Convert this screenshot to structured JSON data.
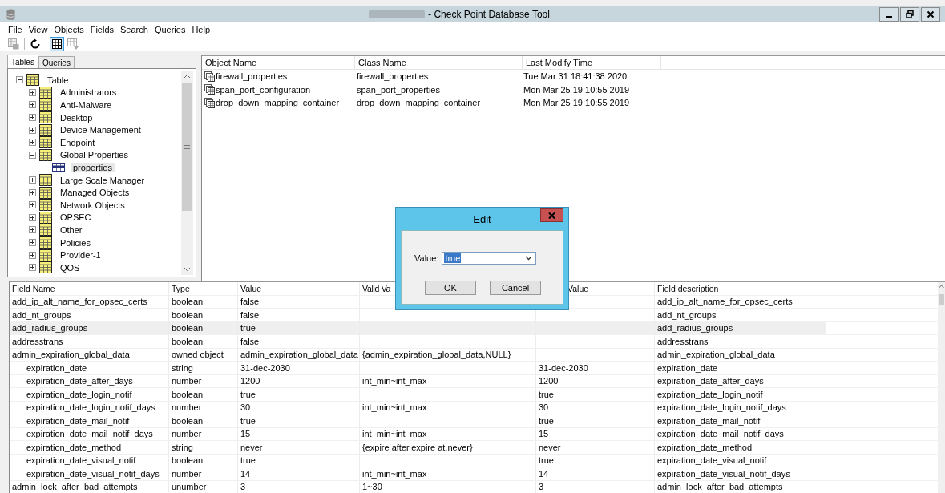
{
  "window": {
    "title": "- Check Point Database Tool"
  },
  "menu": [
    "File",
    "View",
    "Objects",
    "Fields",
    "Search",
    "Queries",
    "Help"
  ],
  "toolbar": [
    {
      "kind": "save",
      "disabled": true,
      "pressed": false
    },
    {
      "kind": "refresh",
      "disabled": false,
      "pressed": false
    },
    {
      "kind": "grid",
      "disabled": false,
      "pressed": true
    },
    {
      "kind": "grid-down",
      "disabled": true,
      "pressed": false
    }
  ],
  "tabs": [
    {
      "label": "Tables",
      "selected": true
    },
    {
      "label": "Queries",
      "selected": false
    }
  ],
  "tree": [
    {
      "label": "Table",
      "kind": "folder",
      "expanded": true,
      "selected": false,
      "children": [
        {
          "label": "Administrators",
          "kind": "folder",
          "expanded": false,
          "selected": false
        },
        {
          "label": "Anti-Malware",
          "kind": "folder",
          "expanded": false,
          "selected": false
        },
        {
          "label": "Desktop",
          "kind": "folder",
          "expanded": false,
          "selected": false
        },
        {
          "label": "Device Management",
          "kind": "folder",
          "expanded": false,
          "selected": false
        },
        {
          "label": "Endpoint",
          "kind": "folder",
          "expanded": false,
          "selected": false
        },
        {
          "label": "Global Properties",
          "kind": "folder",
          "expanded": true,
          "selected": false,
          "children": [
            {
              "label": "properties",
              "kind": "table",
              "selected": true
            }
          ]
        },
        {
          "label": "Large Scale Manager",
          "kind": "folder",
          "expanded": false,
          "selected": false
        },
        {
          "label": "Managed Objects",
          "kind": "folder",
          "expanded": false,
          "selected": false
        },
        {
          "label": "Network Objects",
          "kind": "folder",
          "expanded": false,
          "selected": false
        },
        {
          "label": "OPSEC",
          "kind": "folder",
          "expanded": false,
          "selected": false
        },
        {
          "label": "Other",
          "kind": "folder",
          "expanded": false,
          "selected": false
        },
        {
          "label": "Policies",
          "kind": "folder",
          "expanded": false,
          "selected": false
        },
        {
          "label": "Provider-1",
          "kind": "folder",
          "expanded": false,
          "selected": false
        },
        {
          "label": "QOS",
          "kind": "folder",
          "expanded": false,
          "selected": false
        }
      ]
    }
  ],
  "objects": {
    "columns": [
      "Object Name",
      "Class Name",
      "Last Modify Time"
    ],
    "rows": [
      {
        "name": "firewall_properties",
        "class": "firewall_properties",
        "modified": "Tue Mar 31 18:41:38 2020"
      },
      {
        "name": "span_port_configuration",
        "class": "span_port_properties",
        "modified": "Mon Mar 25 19:10:55 2019"
      },
      {
        "name": "drop_down_mapping_container",
        "class": "drop_down_mapping_container",
        "modified": "Mon Mar 25 19:10:55 2019"
      }
    ]
  },
  "fields": {
    "columns": [
      "Field Name",
      "Type",
      "Value",
      "Valid Va",
      "Value",
      "Field description"
    ],
    "rows": [
      {
        "name": "add_ip_alt_name_for_opsec_certs",
        "type": "boolean",
        "value": "false",
        "description": "add_ip_alt_name_for_opsec_certs",
        "selected": false
      },
      {
        "name": "add_nt_groups",
        "type": "boolean",
        "value": "false",
        "description": "add_nt_groups",
        "selected": false
      },
      {
        "name": "add_radius_groups",
        "type": "boolean",
        "value": "true",
        "description": "add_radius_groups",
        "selected": true
      },
      {
        "name": "addresstrans",
        "type": "boolean",
        "value": "false",
        "description": "addresstrans",
        "selected": false
      },
      {
        "name": "admin_expiration_global_data",
        "type": "owned object",
        "value": "admin_expiration_global_data",
        "valid": "{admin_expiration_global_data,NULL}",
        "description": "admin_expiration_global_data",
        "selected": false,
        "children": [
          {
            "name": "expiration_date",
            "type": "string",
            "value": "31-dec-2030",
            "default": "31-dec-2030",
            "description": "expiration_date",
            "selected": false
          },
          {
            "name": "expiration_date_after_days",
            "type": "number",
            "value": "1200",
            "valid": "int_min~int_max",
            "default": "1200",
            "description": "expiration_date_after_days",
            "selected": false
          },
          {
            "name": "expiration_date_login_notif",
            "type": "boolean",
            "value": "true",
            "default": "true",
            "description": "expiration_date_login_notif",
            "selected": false
          },
          {
            "name": "expiration_date_login_notif_days",
            "type": "number",
            "value": "30",
            "valid": "int_min~int_max",
            "default": "30",
            "description": "expiration_date_login_notif_days",
            "selected": false
          },
          {
            "name": "expiration_date_mail_notif",
            "type": "boolean",
            "value": "true",
            "default": "true",
            "description": "expiration_date_mail_notif",
            "selected": false
          },
          {
            "name": "expiration_date_mail_notif_days",
            "type": "number",
            "value": "15",
            "valid": "int_min~int_max",
            "default": "15",
            "description": "expiration_date_mail_notif_days",
            "selected": false
          },
          {
            "name": "expiration_date_method",
            "type": "string",
            "value": "never",
            "valid": "{expire after,expire at,never}",
            "default": "never",
            "description": "expiration_date_method",
            "selected": false
          },
          {
            "name": "expiration_date_visual_notif",
            "type": "boolean",
            "value": "true",
            "default": "true",
            "description": "expiration_date_visual_notif",
            "selected": false
          },
          {
            "name": "expiration_date_visual_notif_days",
            "type": "number",
            "value": "14",
            "valid": "int_min~int_max",
            "default": "14",
            "description": "expiration_date_visual_notif_days",
            "selected": false
          }
        ]
      },
      {
        "name": "admin_lock_after_bad_attempts",
        "type": "unumber",
        "value": "3",
        "valid": "1~30",
        "default": "3",
        "description": "admin_lock_after_bad_attempts",
        "selected": false
      }
    ]
  },
  "dialog": {
    "title": "Edit",
    "label": "Value:",
    "value": "true",
    "buttons": [
      "OK",
      "Cancel"
    ]
  }
}
